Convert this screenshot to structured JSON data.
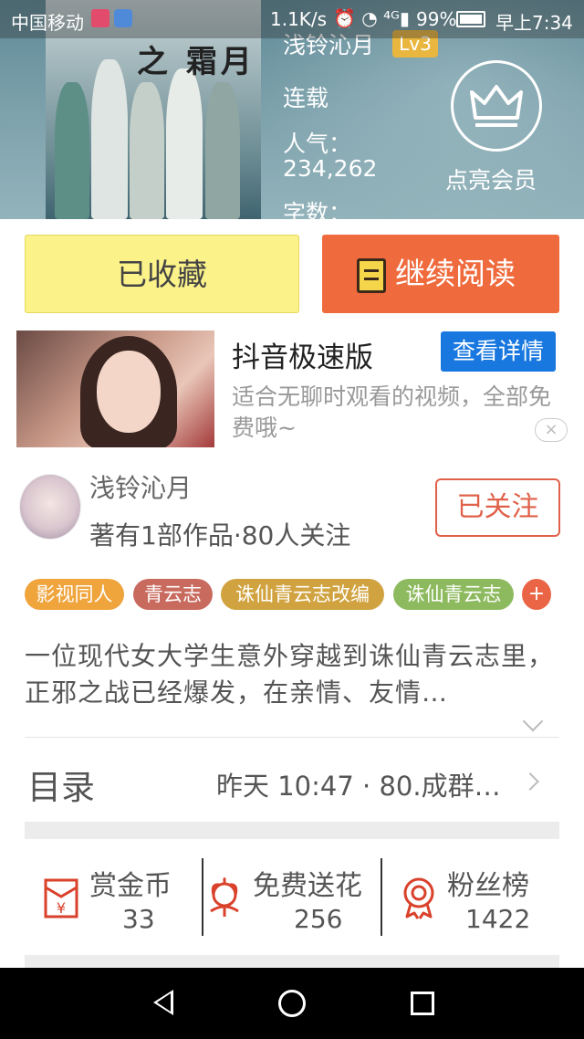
{
  "status_bar": {
    "carrier": "中国移动",
    "net_speed": "1.1K/s",
    "icons": "⏰ ◔ ⁴ᴳ▮",
    "battery": "99%",
    "time": "早上7:34"
  },
  "book": {
    "cover_title": "之 霜月",
    "author": "浅铃沁月",
    "author_level": "Lv3",
    "status": "连载",
    "popularity_label": "人气：",
    "popularity_value": "234,262",
    "wordcount_label": "字数：",
    "vip_label": "点亮会员"
  },
  "actions": {
    "collected_label": "已收藏",
    "continue_label": "继续阅读"
  },
  "ad": {
    "title": "抖音极速版",
    "detail_button": "查看详情",
    "description": "适合无聊时观看的视频，全部免费哦~",
    "close": "×"
  },
  "author_card": {
    "name": "浅铃沁月",
    "stats": "著有1部作品·80人关注",
    "follow_button": "已关注"
  },
  "tags": [
    {
      "label": "影视同人",
      "color": "#efa43c"
    },
    {
      "label": "青云志",
      "color": "#c86a5e"
    },
    {
      "label": "诛仙青云志改编",
      "color": "#d1a340"
    },
    {
      "label": "诛仙青云志",
      "color": "#8dba5e"
    }
  ],
  "tag_more": "+",
  "synopsis": "一位现代女大学生意外穿越到诛仙青云志里，正邪之战已经爆发，在亲情、友情…",
  "toc": {
    "title": "目录",
    "latest": "昨天 10:47 · 80.成群…"
  },
  "stats": {
    "reward": {
      "label": "赏金币",
      "value": "33"
    },
    "flowers": {
      "label": "免费送花",
      "value": "256"
    },
    "fans": {
      "label": "粉丝榜",
      "value": "1422"
    }
  },
  "colors": {
    "accent_orange": "#ef6a3c",
    "collected_yellow": "#fbf28a",
    "ad_blue": "#1878e0",
    "icon_red": "#d9412b"
  }
}
